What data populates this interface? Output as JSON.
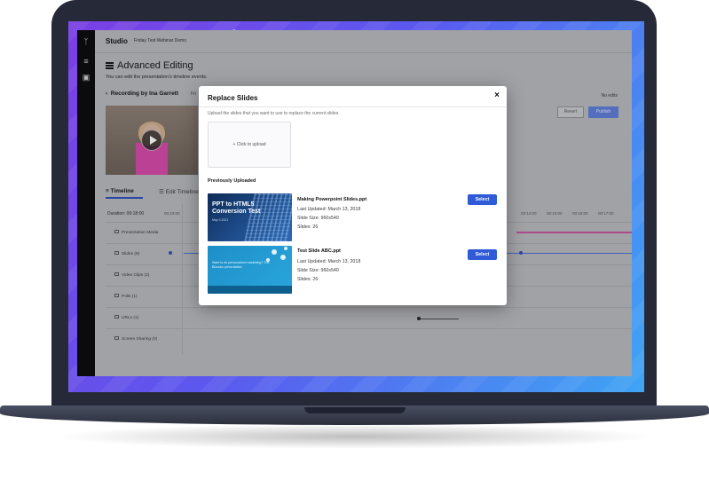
{
  "app": {
    "brand": "Studio",
    "event_name": "Friday Test Webinar Demo"
  },
  "sidebar": {
    "icons": [
      "logo-icon",
      "menu-icon",
      "document-icon"
    ]
  },
  "page": {
    "title": "Advanced Editing",
    "description": "You can edit the presentation's timeline events.",
    "recording": "Recording by Ina Garrett",
    "recording_extra": "Fri",
    "status": "No edits",
    "revert_label": "Revert",
    "publish_label": "Publish"
  },
  "tabs": [
    {
      "label": "Timeline"
    },
    {
      "label": "Edit Timeline"
    }
  ],
  "timeline": {
    "duration": "Duration: 00:18:00",
    "ticks": [
      "00:10:00",
      "00:14:00",
      "00:15:00",
      "00:16:00",
      "00:17:00"
    ],
    "tracks": [
      {
        "label": "Presentation Media"
      },
      {
        "label": "Slides (8)"
      },
      {
        "label": "Video Clips (2)"
      },
      {
        "label": "Polls (1)"
      },
      {
        "label": "URLs (1)"
      },
      {
        "label": "Screen Sharing (0)"
      }
    ]
  },
  "modal": {
    "title": "Replace Slides",
    "close_icon": "×",
    "description": "Upload the slides that you want to use to replace the current slides.",
    "upload_label": "+ Click to upload",
    "previous_heading": "Previously Uploaded",
    "items": [
      {
        "name": "Making Powerpoint Slides.ppt",
        "last_updated": "Last Updated: March 13, 2018",
        "slide_size": "Slide Size: 960x540",
        "slides": "Slides: 26",
        "select_label": "Select",
        "thumb_title": "PPT to HTML5 Conversion Test",
        "thumb_sub": "May 3 2021"
      },
      {
        "name": "Test Slide ABC.ppt",
        "last_updated": "Last Updated: March 13, 2018",
        "slide_size": "Slide Size: 960x540",
        "slides": "Slides: 26",
        "select_label": "Select",
        "thumb_text": "Want to do personalized marketing? The Bizzabo presentation"
      }
    ]
  },
  "colors": {
    "accent": "#2f5bd9",
    "frame": "#262a38",
    "gradient_start": "#7b3fe4",
    "gradient_end": "#3fa4f4"
  }
}
